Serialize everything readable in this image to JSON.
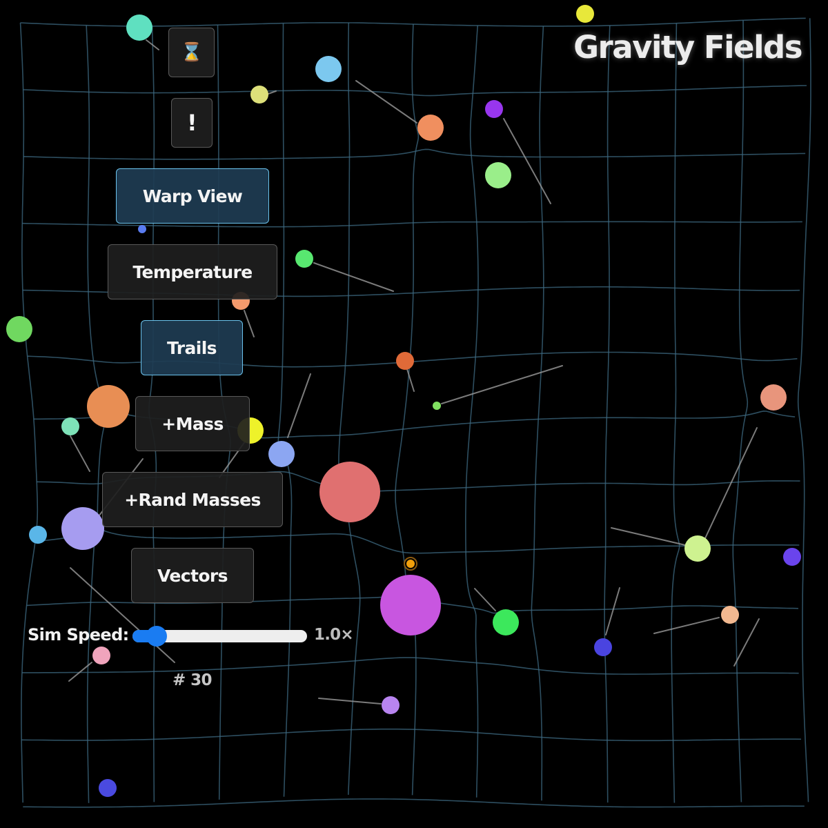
{
  "app": {
    "title": "Gravity Fields"
  },
  "controls": {
    "hourglass_label": "⌛",
    "alert_label": "!",
    "warp_view_label": "Warp View",
    "warp_view_active": true,
    "temperature_label": "Temperature",
    "temperature_active": false,
    "trails_label": "Trails",
    "trails_active": true,
    "add_mass_label": "+Mass",
    "rand_masses_label": "+Rand Masses",
    "vectors_label": "Vectors",
    "vectors_active": false
  },
  "speed": {
    "label": "Sim Speed:",
    "value_text": "1.0×",
    "value": 1.0,
    "min": 0.1,
    "max": 10,
    "fraction": 0.09
  },
  "counter": {
    "text": "# 30"
  },
  "colors": {
    "background": "#000000",
    "grid": "#3e6a82",
    "trail": "#9a9a9a",
    "accent": "#1a7cf2",
    "active_border": "#6cc4ee",
    "active_fill": "#1e3c52"
  },
  "bodies": [
    {
      "color": "#5fe0c0",
      "size": "medium"
    },
    {
      "color": "#e8e83a",
      "size": "small"
    },
    {
      "color": "#7cc8ef",
      "size": "medium"
    },
    {
      "color": "#dde07a",
      "size": "small"
    },
    {
      "color": "#f08f5f",
      "size": "medium"
    },
    {
      "color": "#9836ee",
      "size": "small"
    },
    {
      "color": "#9aee8a",
      "size": "medium"
    },
    {
      "color": "#5a7cf0",
      "size": "tiny"
    },
    {
      "color": "#58e870",
      "size": "small"
    },
    {
      "color": "#f49a6c",
      "size": "small"
    },
    {
      "color": "#70d860",
      "size": "medium"
    },
    {
      "color": "#e06a38",
      "size": "small"
    },
    {
      "color": "#80e060",
      "size": "tiny"
    },
    {
      "color": "#e8957c",
      "size": "medium"
    },
    {
      "color": "#e88e54",
      "size": "large"
    },
    {
      "color": "#7ee2b8",
      "size": "small"
    },
    {
      "color": "#eef22a",
      "size": "medium"
    },
    {
      "color": "#8ca6f2",
      "size": "medium"
    },
    {
      "color": "#e07070",
      "size": "huge"
    },
    {
      "color": "#a69cf0",
      "size": "large"
    },
    {
      "color": "#5ab6e8",
      "size": "small"
    },
    {
      "color": "#cef290",
      "size": "medium"
    },
    {
      "color": "#6a44ec",
      "size": "small"
    },
    {
      "color": "#f2a00c",
      "size": "tiny"
    },
    {
      "color": "#c856e0",
      "size": "huge"
    },
    {
      "color": "#3ce85c",
      "size": "medium"
    },
    {
      "color": "#4a44e0",
      "size": "small"
    },
    {
      "color": "#f2b890",
      "size": "small"
    },
    {
      "color": "#f0a4bc",
      "size": "small"
    },
    {
      "color": "#b884f0",
      "size": "small"
    },
    {
      "color": "#4a4ae0",
      "size": "small"
    }
  ]
}
